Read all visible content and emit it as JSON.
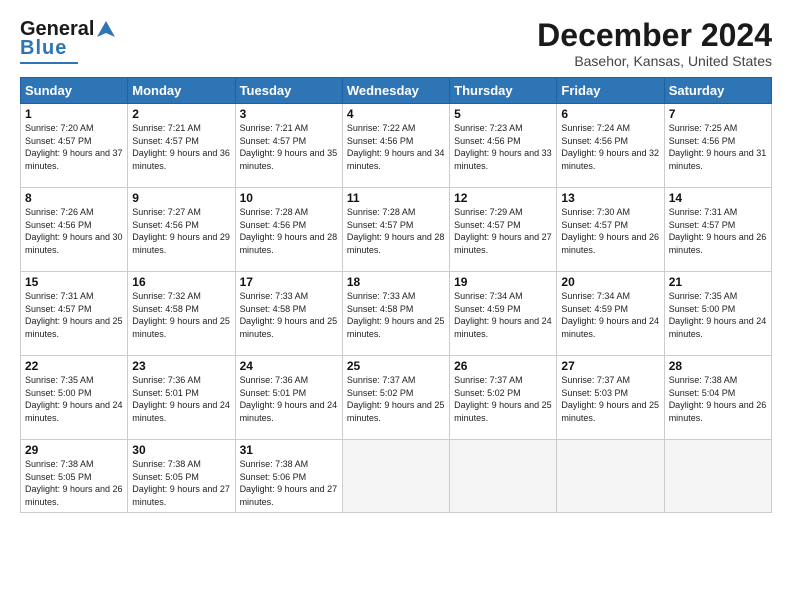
{
  "header": {
    "logo_general": "General",
    "logo_blue": "Blue",
    "month_title": "December 2024",
    "location": "Basehor, Kansas, United States"
  },
  "days_of_week": [
    "Sunday",
    "Monday",
    "Tuesday",
    "Wednesday",
    "Thursday",
    "Friday",
    "Saturday"
  ],
  "weeks": [
    [
      {
        "num": "1",
        "sunrise": "Sunrise: 7:20 AM",
        "sunset": "Sunset: 4:57 PM",
        "daylight": "Daylight: 9 hours and 37 minutes."
      },
      {
        "num": "2",
        "sunrise": "Sunrise: 7:21 AM",
        "sunset": "Sunset: 4:57 PM",
        "daylight": "Daylight: 9 hours and 36 minutes."
      },
      {
        "num": "3",
        "sunrise": "Sunrise: 7:21 AM",
        "sunset": "Sunset: 4:57 PM",
        "daylight": "Daylight: 9 hours and 35 minutes."
      },
      {
        "num": "4",
        "sunrise": "Sunrise: 7:22 AM",
        "sunset": "Sunset: 4:56 PM",
        "daylight": "Daylight: 9 hours and 34 minutes."
      },
      {
        "num": "5",
        "sunrise": "Sunrise: 7:23 AM",
        "sunset": "Sunset: 4:56 PM",
        "daylight": "Daylight: 9 hours and 33 minutes."
      },
      {
        "num": "6",
        "sunrise": "Sunrise: 7:24 AM",
        "sunset": "Sunset: 4:56 PM",
        "daylight": "Daylight: 9 hours and 32 minutes."
      },
      {
        "num": "7",
        "sunrise": "Sunrise: 7:25 AM",
        "sunset": "Sunset: 4:56 PM",
        "daylight": "Daylight: 9 hours and 31 minutes."
      }
    ],
    [
      {
        "num": "8",
        "sunrise": "Sunrise: 7:26 AM",
        "sunset": "Sunset: 4:56 PM",
        "daylight": "Daylight: 9 hours and 30 minutes."
      },
      {
        "num": "9",
        "sunrise": "Sunrise: 7:27 AM",
        "sunset": "Sunset: 4:56 PM",
        "daylight": "Daylight: 9 hours and 29 minutes."
      },
      {
        "num": "10",
        "sunrise": "Sunrise: 7:28 AM",
        "sunset": "Sunset: 4:56 PM",
        "daylight": "Daylight: 9 hours and 28 minutes."
      },
      {
        "num": "11",
        "sunrise": "Sunrise: 7:28 AM",
        "sunset": "Sunset: 4:57 PM",
        "daylight": "Daylight: 9 hours and 28 minutes."
      },
      {
        "num": "12",
        "sunrise": "Sunrise: 7:29 AM",
        "sunset": "Sunset: 4:57 PM",
        "daylight": "Daylight: 9 hours and 27 minutes."
      },
      {
        "num": "13",
        "sunrise": "Sunrise: 7:30 AM",
        "sunset": "Sunset: 4:57 PM",
        "daylight": "Daylight: 9 hours and 26 minutes."
      },
      {
        "num": "14",
        "sunrise": "Sunrise: 7:31 AM",
        "sunset": "Sunset: 4:57 PM",
        "daylight": "Daylight: 9 hours and 26 minutes."
      }
    ],
    [
      {
        "num": "15",
        "sunrise": "Sunrise: 7:31 AM",
        "sunset": "Sunset: 4:57 PM",
        "daylight": "Daylight: 9 hours and 25 minutes."
      },
      {
        "num": "16",
        "sunrise": "Sunrise: 7:32 AM",
        "sunset": "Sunset: 4:58 PM",
        "daylight": "Daylight: 9 hours and 25 minutes."
      },
      {
        "num": "17",
        "sunrise": "Sunrise: 7:33 AM",
        "sunset": "Sunset: 4:58 PM",
        "daylight": "Daylight: 9 hours and 25 minutes."
      },
      {
        "num": "18",
        "sunrise": "Sunrise: 7:33 AM",
        "sunset": "Sunset: 4:58 PM",
        "daylight": "Daylight: 9 hours and 25 minutes."
      },
      {
        "num": "19",
        "sunrise": "Sunrise: 7:34 AM",
        "sunset": "Sunset: 4:59 PM",
        "daylight": "Daylight: 9 hours and 24 minutes."
      },
      {
        "num": "20",
        "sunrise": "Sunrise: 7:34 AM",
        "sunset": "Sunset: 4:59 PM",
        "daylight": "Daylight: 9 hours and 24 minutes."
      },
      {
        "num": "21",
        "sunrise": "Sunrise: 7:35 AM",
        "sunset": "Sunset: 5:00 PM",
        "daylight": "Daylight: 9 hours and 24 minutes."
      }
    ],
    [
      {
        "num": "22",
        "sunrise": "Sunrise: 7:35 AM",
        "sunset": "Sunset: 5:00 PM",
        "daylight": "Daylight: 9 hours and 24 minutes."
      },
      {
        "num": "23",
        "sunrise": "Sunrise: 7:36 AM",
        "sunset": "Sunset: 5:01 PM",
        "daylight": "Daylight: 9 hours and 24 minutes."
      },
      {
        "num": "24",
        "sunrise": "Sunrise: 7:36 AM",
        "sunset": "Sunset: 5:01 PM",
        "daylight": "Daylight: 9 hours and 24 minutes."
      },
      {
        "num": "25",
        "sunrise": "Sunrise: 7:37 AM",
        "sunset": "Sunset: 5:02 PM",
        "daylight": "Daylight: 9 hours and 25 minutes."
      },
      {
        "num": "26",
        "sunrise": "Sunrise: 7:37 AM",
        "sunset": "Sunset: 5:02 PM",
        "daylight": "Daylight: 9 hours and 25 minutes."
      },
      {
        "num": "27",
        "sunrise": "Sunrise: 7:37 AM",
        "sunset": "Sunset: 5:03 PM",
        "daylight": "Daylight: 9 hours and 25 minutes."
      },
      {
        "num": "28",
        "sunrise": "Sunrise: 7:38 AM",
        "sunset": "Sunset: 5:04 PM",
        "daylight": "Daylight: 9 hours and 26 minutes."
      }
    ],
    [
      {
        "num": "29",
        "sunrise": "Sunrise: 7:38 AM",
        "sunset": "Sunset: 5:05 PM",
        "daylight": "Daylight: 9 hours and 26 minutes."
      },
      {
        "num": "30",
        "sunrise": "Sunrise: 7:38 AM",
        "sunset": "Sunset: 5:05 PM",
        "daylight": "Daylight: 9 hours and 27 minutes."
      },
      {
        "num": "31",
        "sunrise": "Sunrise: 7:38 AM",
        "sunset": "Sunset: 5:06 PM",
        "daylight": "Daylight: 9 hours and 27 minutes."
      },
      null,
      null,
      null,
      null
    ]
  ]
}
